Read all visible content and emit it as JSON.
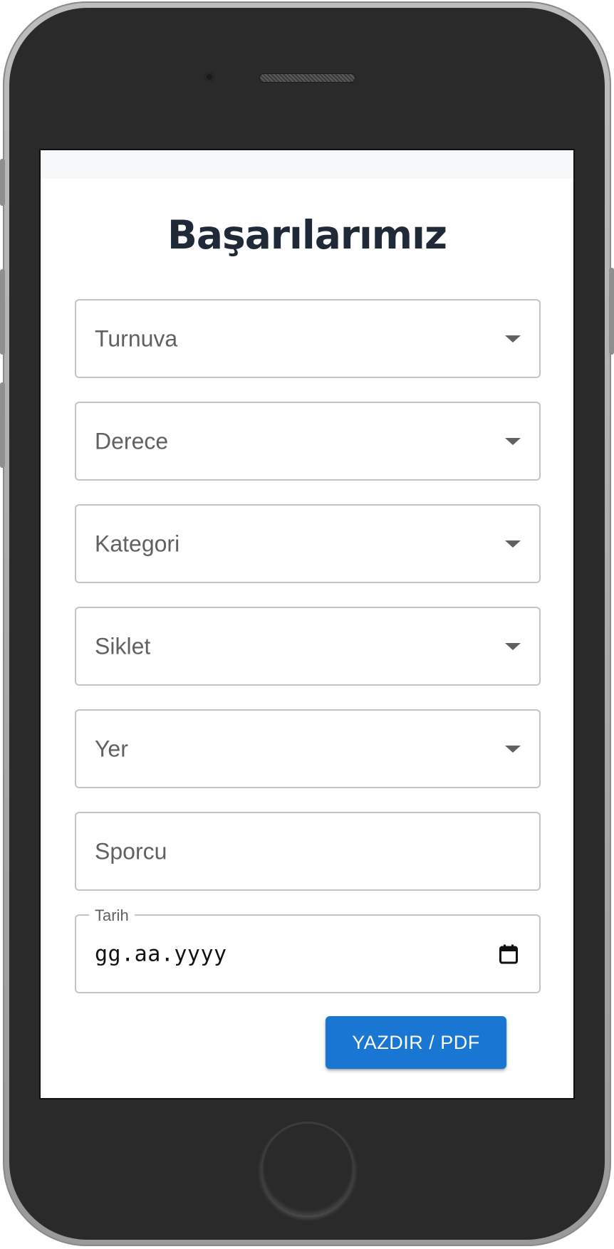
{
  "page": {
    "title": "Başarılarımız"
  },
  "form": {
    "fields": [
      {
        "label": "Turnuva",
        "type": "select"
      },
      {
        "label": "Derece",
        "type": "select"
      },
      {
        "label": "Kategori",
        "type": "select"
      },
      {
        "label": "Siklet",
        "type": "select"
      },
      {
        "label": "Yer",
        "type": "select"
      },
      {
        "label": "Sporcu",
        "type": "text"
      }
    ],
    "date": {
      "label": "Tarih",
      "placeholder": "gg.aa.yyyy"
    },
    "print_button_label": "YAZDIR / PDF"
  },
  "colors": {
    "accent": "#1976d2",
    "title": "#1f2937",
    "border": "#c4c4c4",
    "label": "#616161"
  },
  "icons": {
    "dropdown": "caret-down-icon",
    "date": "calendar-icon"
  }
}
